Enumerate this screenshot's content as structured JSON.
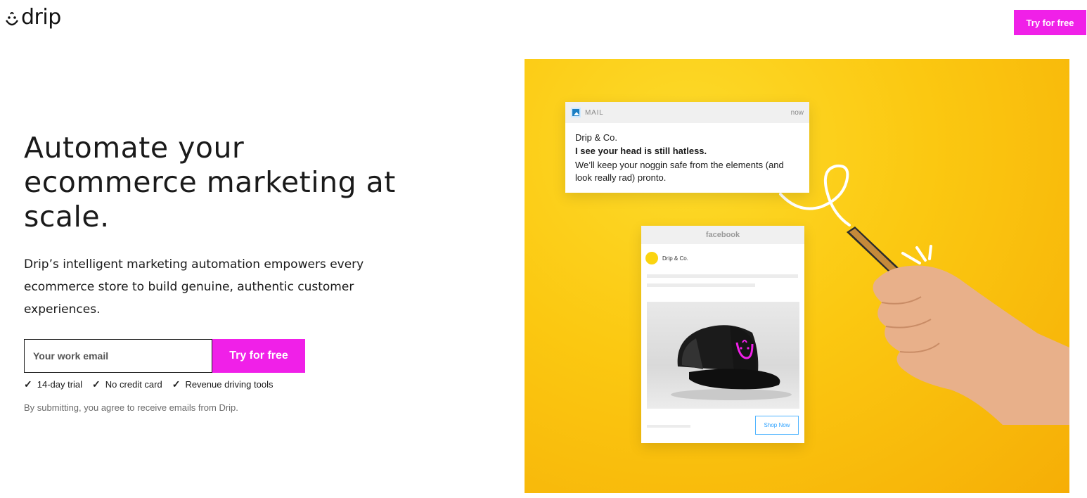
{
  "header": {
    "logo_text": "drip",
    "cta_label": "Try for free"
  },
  "hero": {
    "headline": "Automate your ecommerce marketing at scale.",
    "subcopy": "Drip’s intelligent marketing automation empowers every ecommerce store to build genuine, authentic customer experiences.",
    "email_placeholder": "Your work email",
    "submit_label": "Try for free",
    "perks": [
      "14-day trial",
      "No credit card",
      "Revenue driving tools"
    ],
    "disclaimer": "By submitting, you agree to receive emails from Drip."
  },
  "illustration": {
    "background_color": "#fbc811",
    "mail_notification": {
      "app": "MAIL",
      "time": "now",
      "sender": "Drip & Co.",
      "subject": "I see your head is still hatless.",
      "body": "We’ll keep your noggin safe from the elements (and look really rad) pronto."
    },
    "facebook_ad": {
      "network": "facebook",
      "page_name": "Drip & Co.",
      "button_label": "Shop Now"
    }
  },
  "colors": {
    "accent": "#f020e8",
    "hero_yellow": "#fbc811"
  }
}
